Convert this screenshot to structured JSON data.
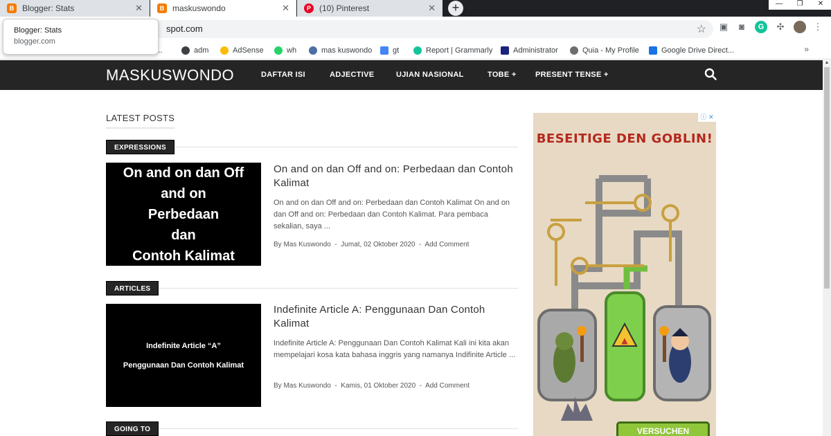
{
  "browser": {
    "tabs": [
      {
        "title": "Blogger: Stats",
        "fav_color": "#f57c00",
        "fav_glyph": "B"
      },
      {
        "title": "maskuswondo",
        "fav_color": "#f57c00",
        "fav_glyph": "B"
      },
      {
        "title": "(10) Pinterest",
        "fav_color": "#e60023",
        "fav_glyph": "P"
      }
    ],
    "new_tab_glyph": "+",
    "url_visible": "spot.com",
    "tooltip": {
      "title": "Blogger: Stats",
      "domain": "blogger.com"
    },
    "bookmarks": [
      {
        "label": "B...",
        "color": "#f57c00"
      },
      {
        "label": "adm",
        "color": "#3c4043"
      },
      {
        "label": "AdSense",
        "color": "#fbbc04"
      },
      {
        "label": "wh",
        "color": "#25d366"
      },
      {
        "label": "mas kuswondo",
        "color": "#4a6fa5"
      },
      {
        "label": "gt",
        "color": "#4285f4"
      },
      {
        "label": "Report | Grammarly",
        "color": "#15c39a"
      },
      {
        "label": "Administrator",
        "color": "#1a237e"
      },
      {
        "label": "Quia - My Profile",
        "color": "#6d6d6d"
      },
      {
        "label": "Google Drive Direct...",
        "color": "#1a73e8"
      }
    ],
    "bookmarks_more": "»"
  },
  "blog": {
    "name": "MASKUSWONDO",
    "nav": [
      {
        "label": "DAFTAR ISI"
      },
      {
        "label": "ADJECTIVE"
      },
      {
        "label": "UJIAN NASIONAL"
      },
      {
        "label": "TOBE +"
      },
      {
        "label": "PRESENT TENSE +"
      }
    ],
    "section_title": "LATEST POSTS",
    "posts": [
      {
        "category": "EXPRESSIONS",
        "thumb_lines": [
          "On and on dan Off",
          "and on",
          "Perbedaan",
          "dan",
          "Contoh Kalimat"
        ],
        "title": "On and on dan Off and on: Perbedaan dan Contoh Kalimat",
        "excerpt": "On and on dan Off and on: Perbedaan dan Contoh Kalimat On and on dan Off and on: Perbedaan dan Contoh Kalimat.  Para pembaca sekalian, saya ...",
        "author": "By Mas Kuswondo",
        "date": "Jumat, 02 Oktober 2020",
        "comment": "Add Comment"
      },
      {
        "category": "ARTICLES",
        "thumb_lines": [
          "Indefinite Article “A”",
          "Penggunaan Dan Contoh Kalimat"
        ],
        "title": "Indefinite Article A: Penggunaan Dan Contoh Kalimat",
        "excerpt": "Indefinite Article A: Penggunaan Dan Contoh Kalimat Kali ini kita akan mempelajari kosa kata bahasa inggris yang namanya Indifinite Article ...",
        "author": "By Mas Kuswondo",
        "date": "Kamis, 01 Oktober 2020",
        "comment": "Add Comment"
      },
      {
        "category": "GOING TO"
      }
    ],
    "meta_separator": "-"
  },
  "ad": {
    "info_glyph": "ⓘ ✕",
    "headline": "BESEITIGE DEN GOBLIN!",
    "cta": "VERSUCHEN"
  }
}
